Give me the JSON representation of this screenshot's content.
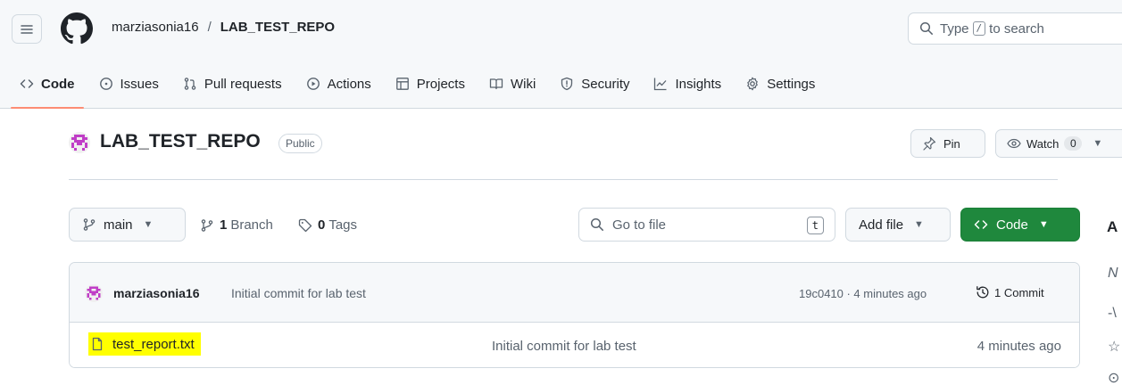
{
  "header": {
    "owner": "marziasonia16",
    "separator": "/",
    "repo": "LAB_TEST_REPO",
    "search": {
      "prefix": "Type",
      "key": "/",
      "suffix": "to search"
    }
  },
  "tabs": [
    {
      "label": "Code",
      "icon": "code-icon"
    },
    {
      "label": "Issues",
      "icon": "issue-icon"
    },
    {
      "label": "Pull requests",
      "icon": "pull-request-icon"
    },
    {
      "label": "Actions",
      "icon": "play-icon"
    },
    {
      "label": "Projects",
      "icon": "table-icon"
    },
    {
      "label": "Wiki",
      "icon": "book-icon"
    },
    {
      "label": "Security",
      "icon": "shield-icon"
    },
    {
      "label": "Insights",
      "icon": "graph-icon"
    },
    {
      "label": "Settings",
      "icon": "gear-icon"
    }
  ],
  "repo_header": {
    "name": "LAB_TEST_REPO",
    "visibility": "Public",
    "pin_label": "Pin",
    "watch_label": "Watch",
    "watch_count": "0"
  },
  "toolbar": {
    "branch": "main",
    "branch_count": "1",
    "branch_label": "Branch",
    "tag_count": "0",
    "tag_label": "Tags",
    "goto_placeholder": "Go to file",
    "goto_key": "t",
    "add_file": "Add file",
    "code": "Code"
  },
  "about_initial": "A",
  "sidebar_fragments": [
    "N",
    "-\\",
    "☆",
    "⊙"
  ],
  "commit": {
    "author": "marziasonia16",
    "message": "Initial commit for lab test",
    "hash_time": "19c0410 · 4 minutes ago",
    "count_label": "1 Commit"
  },
  "files": [
    {
      "name": "test_report.txt",
      "message": "Initial commit for lab test",
      "time": "4 minutes ago"
    }
  ],
  "colors": {
    "accent_tab": "#fd8c73",
    "code_button": "#1f883d",
    "highlight": "#ffff00",
    "avatar": "#c03ec7"
  }
}
